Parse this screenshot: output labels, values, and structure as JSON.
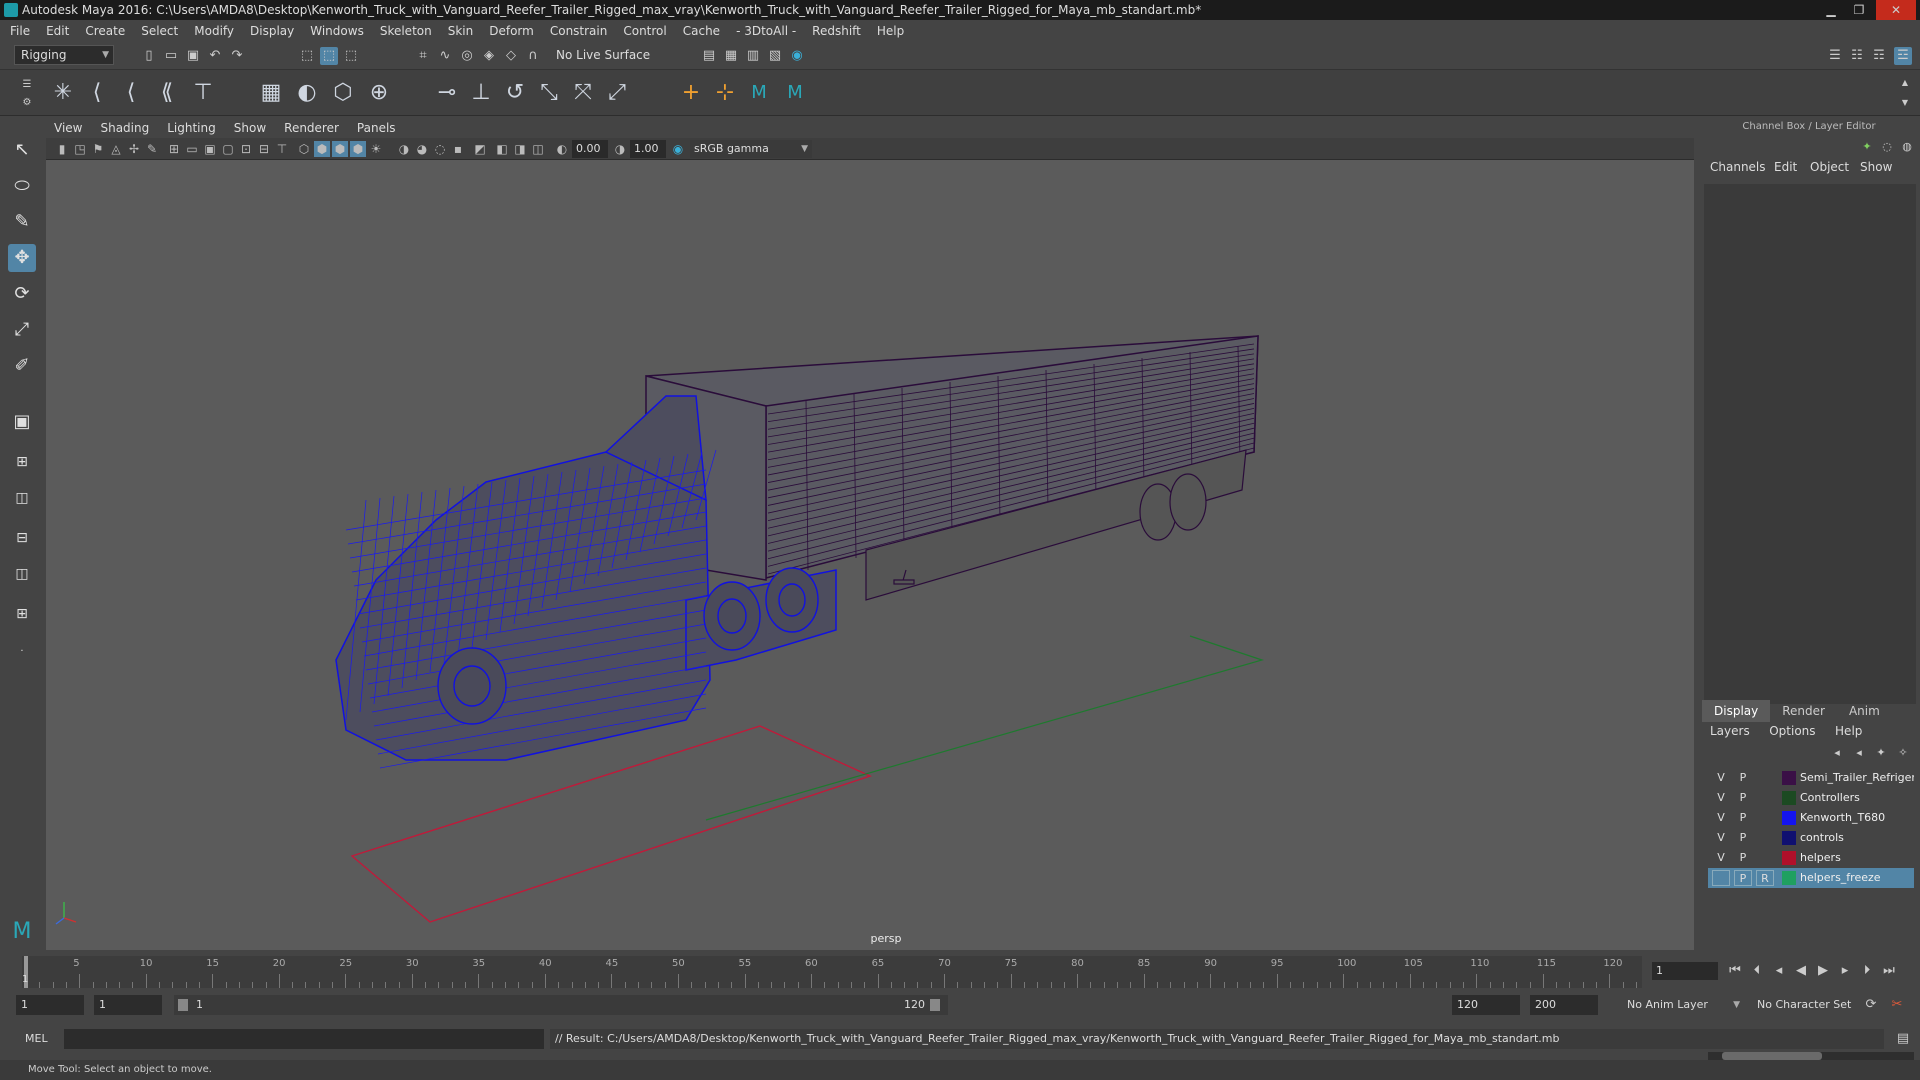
{
  "window": {
    "title": "Autodesk Maya 2016: C:\\Users\\AMDA8\\Desktop\\Kenworth_Truck_with_Vanguard_Reefer_Trailer_Rigged_max_vray\\Kenworth_Truck_with_Vanguard_Reefer_Trailer_Rigged_for_Maya_mb_standart.mb*",
    "minimize": "▁",
    "restore": "❐",
    "close": "✕"
  },
  "menubar": [
    "File",
    "Edit",
    "Create",
    "Select",
    "Modify",
    "Display",
    "Windows",
    "Skeleton",
    "Skin",
    "Deform",
    "Constrain",
    "Control",
    "Cache",
    "- 3DtoAll -",
    "Redshift",
    "Help"
  ],
  "statusline": {
    "mode": "Rigging",
    "live_surface": "No Live Surface"
  },
  "viewport": {
    "menu": [
      "View",
      "Shading",
      "Lighting",
      "Show",
      "Renderer",
      "Panels"
    ],
    "exposure": "0.00",
    "gamma": "1.00",
    "color_space": "sRGB gamma",
    "camera_label": "persp"
  },
  "channel_box": {
    "title": "Channel Box / Layer Editor",
    "tabs": [
      "Channels",
      "Edit",
      "Object",
      "Show"
    ]
  },
  "layer_editor": {
    "tabs": [
      "Display",
      "Render",
      "Anim"
    ],
    "menu": [
      "Layers",
      "Options",
      "Help"
    ],
    "layers": [
      {
        "v": "V",
        "p": "P",
        "r": "",
        "color": "#3a1046",
        "name": "Semi_Trailer_Refrigerator"
      },
      {
        "v": "V",
        "p": "P",
        "r": "",
        "color": "#1c4a22",
        "name": "Controllers"
      },
      {
        "v": "V",
        "p": "P",
        "r": "",
        "color": "#1414ee",
        "name": "Kenworth_T680"
      },
      {
        "v": "V",
        "p": "P",
        "r": "",
        "color": "#101070",
        "name": "controls"
      },
      {
        "v": "V",
        "p": "P",
        "r": "",
        "color": "#b0102a",
        "name": "helpers"
      },
      {
        "v": "",
        "p": "P",
        "r": "R",
        "color": "#1fa060",
        "name": "helpers_freeze"
      }
    ]
  },
  "timeline": {
    "ticks": [
      "5",
      "10",
      "15",
      "20",
      "25",
      "30",
      "35",
      "40",
      "45",
      "50",
      "55",
      "60",
      "65",
      "70",
      "75",
      "80",
      "85",
      "90",
      "95",
      "100",
      "105",
      "110",
      "115",
      "120"
    ],
    "current_frame": "1",
    "left_marker": "1"
  },
  "range": {
    "start": "1",
    "anim_start": "1",
    "slider_start": "1",
    "slider_end": "120",
    "anim_end": "120",
    "playback_end": "200",
    "anim_layer": "No Anim Layer",
    "char_set": "No Character Set"
  },
  "command_line": {
    "lang": "MEL",
    "result": "// Result: C:/Users/AMDA8/Desktop/Kenworth_Truck_with_Vanguard_Reefer_Trailer_Rigged_max_vray/Kenworth_Truck_with_Vanguard_Reefer_Trailer_Rigged_for_Maya_mb_standart.mb"
  },
  "help_line": "Move Tool: Select an object to move."
}
